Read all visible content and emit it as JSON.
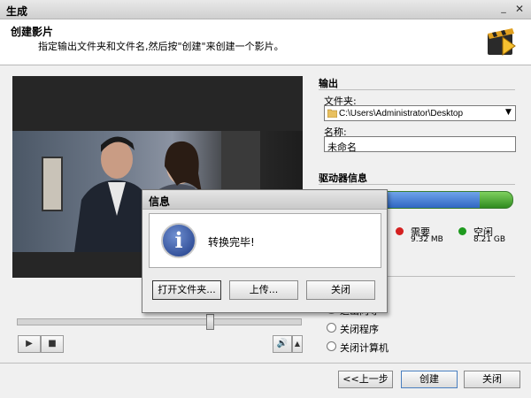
{
  "window": {
    "title": "生成"
  },
  "header": {
    "title": "创建影片",
    "subtitle": "指定输出文件夹和文件名,然后按\"创建\"来创建一个影片。"
  },
  "output": {
    "section_label": "输出",
    "folder_label": "文件夹:",
    "folder_value": "C:\\Users\\Administrator\\Desktop",
    "name_label": "名称:",
    "name_value": "未命名"
  },
  "drive": {
    "section_label": "驱动器信息",
    "required_label": "需要",
    "required_value": "9.32 MB",
    "free_label": "空闲",
    "free_value": "8.21 GB",
    "used_fraction": 0.83,
    "colors": {
      "used": "#2f66c2",
      "free": "#2f8a1e",
      "required_dot": "#d42020",
      "free_dot": "#1e9a1e"
    }
  },
  "after": {
    "partial_label": "退出向导",
    "options": [
      "关闭程序",
      "关闭计算机"
    ]
  },
  "player": {
    "seek_position": 0.68,
    "icons": [
      "play-icon",
      "stop-icon",
      "volume-icon"
    ]
  },
  "dialog": {
    "title": "信息",
    "message": "转换完毕!",
    "buttons": {
      "open": "打开文件夹...",
      "upload": "上传...",
      "close": "关闭"
    }
  },
  "footer": {
    "back": "<<上一步",
    "create": "创建",
    "close": "关闭"
  }
}
